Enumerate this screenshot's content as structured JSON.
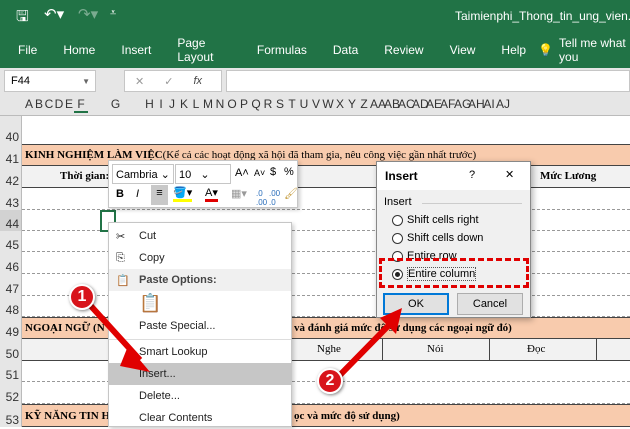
{
  "title_bar": {
    "filename": "Taimienphi_Thong_tin_ung_vien.xls"
  },
  "ribbon_tabs": [
    "File",
    "Home",
    "Insert",
    "Page Layout",
    "Formulas",
    "Data",
    "Review",
    "View",
    "Help"
  ],
  "tell_me": "Tell me what you",
  "name_box": "F44",
  "fx": "fx",
  "columns": [
    "A",
    "B",
    "C",
    "D",
    "E",
    "F",
    "G",
    "H",
    "I",
    "J",
    "K",
    "L",
    "M",
    "N",
    "O",
    "P",
    "Q",
    "R",
    "S",
    "T",
    "U",
    "V",
    "W",
    "X",
    "Y",
    "Z",
    "AA",
    "AB",
    "AC",
    "AD",
    "AE",
    "AF",
    "AG",
    "AH",
    "AI",
    "AJ"
  ],
  "rows": [
    "40",
    "41",
    "42",
    "43",
    "44",
    "45",
    "46",
    "47",
    "48",
    "49",
    "50",
    "51",
    "52",
    "53"
  ],
  "sheet": {
    "row41_bold": "KINH NGHIỆM LÀM VIỆC",
    "row41_rest": " (Kể cả các hoạt động xã hội đã tham gia, nêu công việc gần nhất trước)",
    "row42_time": "Thời gian:",
    "row42_salary": "Mức Lương",
    "row49_left": "NGOẠI NGỮ  (N",
    "row49_right": "và đánh giá mức độ sử dụng các ngoại ngữ đó)",
    "row50": [
      "Nghe",
      "Nói",
      "Đọc"
    ],
    "row53_left": "KỸ NĂNG TIN HỌ",
    "row53_right": "ọc và mức độ sử dụng)"
  },
  "mini_toolbar": {
    "font": "Cambria",
    "size": "10",
    "bold": "B",
    "italic": "I",
    "currency": "$",
    "percent": "%",
    "comma": ","
  },
  "context_menu": {
    "cut": "Cut",
    "copy": "Copy",
    "paste_options": "Paste Options:",
    "paste_special": "Paste Special...",
    "smart_lookup": "Smart Lookup",
    "insert": "Insert...",
    "delete": "Delete...",
    "clear": "Clear Contents"
  },
  "dialog": {
    "title": "Insert",
    "help": "?",
    "close": "✕",
    "group": "Insert",
    "options": [
      "Shift cells right",
      "Shift cells down",
      "Entire row",
      "Entire column"
    ],
    "selected": "Entire column",
    "ok": "OK",
    "cancel": "Cancel"
  },
  "annotations": [
    "1",
    "2"
  ],
  "colors": {
    "excel_green": "#217346",
    "orange": "#f8cbad",
    "highlight": "#e00000"
  }
}
